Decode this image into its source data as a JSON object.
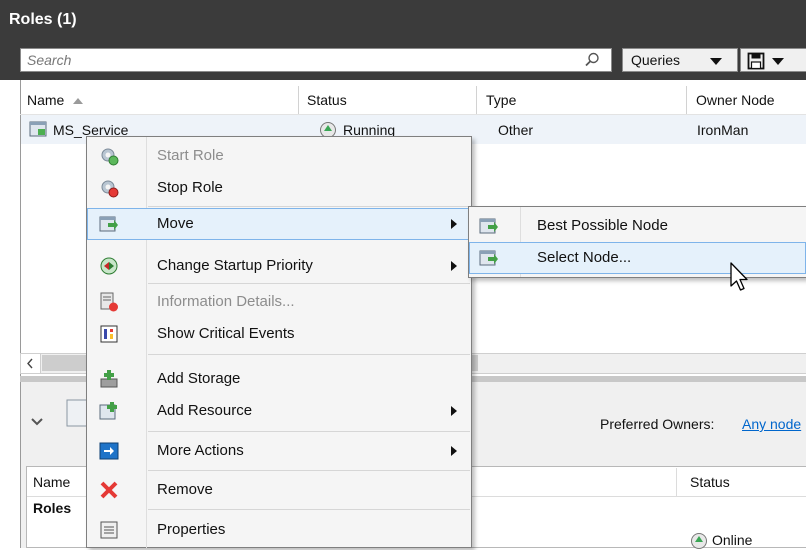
{
  "title": "Roles (1)",
  "search": {
    "placeholder": "Search"
  },
  "toolbar": {
    "queries_label": "Queries"
  },
  "columns": [
    "Name",
    "Status",
    "Type",
    "Owner Node"
  ],
  "rows": [
    {
      "name": "MS_Service",
      "status": "Running",
      "type": "Other",
      "owner": "IronMan"
    }
  ],
  "context_menu": [
    {
      "label": "Start Role",
      "icon": "start-role-icon",
      "disabled": true
    },
    {
      "label": "Stop Role",
      "icon": "stop-role-icon"
    },
    {
      "label": "Move",
      "icon": "move-icon",
      "submenu": true,
      "highlighted": true
    },
    {
      "label": "Change Startup Priority",
      "icon": "priority-icon",
      "submenu": true
    },
    {
      "label": "Information Details...",
      "icon": "information-details-icon",
      "disabled": true
    },
    {
      "label": "Show Critical Events",
      "icon": "critical-events-icon"
    },
    {
      "label": "Add Storage",
      "icon": "add-storage-icon"
    },
    {
      "label": "Add Resource",
      "icon": "add-resource-icon",
      "submenu": true
    },
    {
      "label": "More Actions",
      "icon": "more-actions-icon",
      "submenu": true
    },
    {
      "label": "Remove",
      "icon": "remove-icon"
    },
    {
      "label": "Properties",
      "icon": "properties-icon"
    }
  ],
  "submenu": [
    {
      "label": "Best Possible Node",
      "icon": "move-node-icon"
    },
    {
      "label": "Select Node...",
      "icon": "move-node-icon",
      "highlighted": true
    }
  ],
  "summary": {
    "preferred_owners_label": "Preferred Owners:",
    "preferred_owners_value": "Any node"
  },
  "resources_table": {
    "columns": [
      "Name",
      "Status"
    ],
    "group": "Roles",
    "status_value": "Online"
  },
  "colors": {
    "titlebar": "#3b3b3b",
    "highlight": "#e5f1fb",
    "highlight_border": "#7eb4ea",
    "link": "#0066cc"
  }
}
